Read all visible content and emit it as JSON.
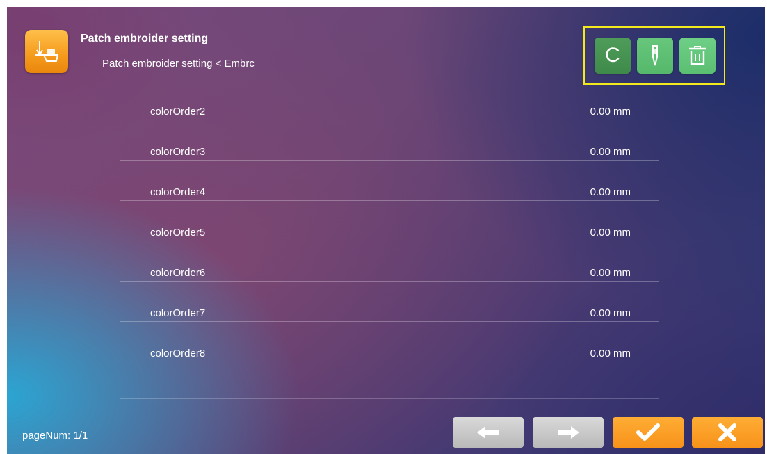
{
  "header": {
    "title": "Patch embroider setting",
    "breadcrumb": "Patch embroider setting < Embrc",
    "app_icon": "patch-embroider-icon"
  },
  "toolbar": {
    "buttons": [
      {
        "name": "c-button",
        "label": "C",
        "icon": "letter-c",
        "color": "#4a9755"
      },
      {
        "name": "needle-button",
        "icon": "needle-icon",
        "color": "#5fc075"
      },
      {
        "name": "delete-button",
        "icon": "trash-icon",
        "color": "#63c67a"
      }
    ],
    "highlight_color": "#f2ea1c"
  },
  "rows": [
    {
      "label": "colorOrder2",
      "value": "0.00 mm"
    },
    {
      "label": "colorOrder3",
      "value": "0.00 mm"
    },
    {
      "label": "colorOrder4",
      "value": "0.00 mm"
    },
    {
      "label": "colorOrder5",
      "value": "0.00 mm"
    },
    {
      "label": "colorOrder6",
      "value": "0.00 mm"
    },
    {
      "label": "colorOrder7",
      "value": "0.00 mm"
    },
    {
      "label": "colorOrder8",
      "value": "0.00 mm"
    }
  ],
  "footer": {
    "page_num": "pageNum: 1/1",
    "buttons": [
      {
        "name": "prev-page-button",
        "icon": "arrow-left-icon",
        "color": "#c8c8c8"
      },
      {
        "name": "next-page-button",
        "icon": "arrow-right-icon",
        "color": "#c8c8c8"
      },
      {
        "name": "confirm-button",
        "icon": "check-icon",
        "color": "#f7921a"
      },
      {
        "name": "cancel-button",
        "icon": "close-icon",
        "color": "#f7921a"
      }
    ]
  }
}
